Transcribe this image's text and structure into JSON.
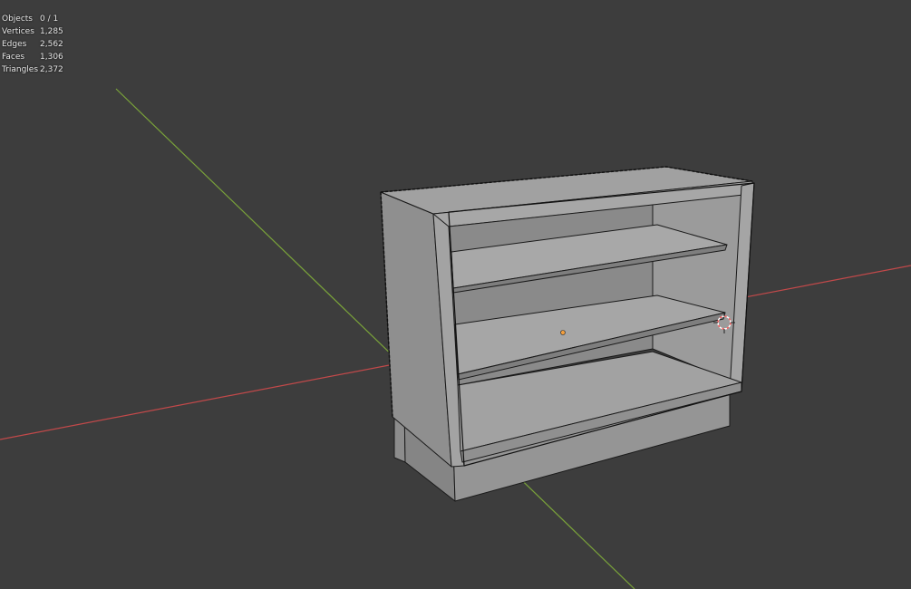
{
  "stats": [
    {
      "label": "Objects",
      "value": "0 / 1"
    },
    {
      "label": "Vertices",
      "value": "1,285"
    },
    {
      "label": "Edges",
      "value": "2,562"
    },
    {
      "label": "Faces",
      "value": "1,306"
    },
    {
      "label": "Triangles",
      "value": "2,372"
    }
  ],
  "colors": {
    "background": "#3d3d3d",
    "x_axis": "#c2494a",
    "y_axis": "#7aa33a",
    "mesh_face": "#9a9a9a",
    "mesh_edge": "#1a1a1a",
    "origin": "#f29e3d",
    "cursor": "#ff5f5f"
  },
  "icons": {
    "object_origin": "origin-dot-icon",
    "3d_cursor": "3d-cursor-icon"
  }
}
